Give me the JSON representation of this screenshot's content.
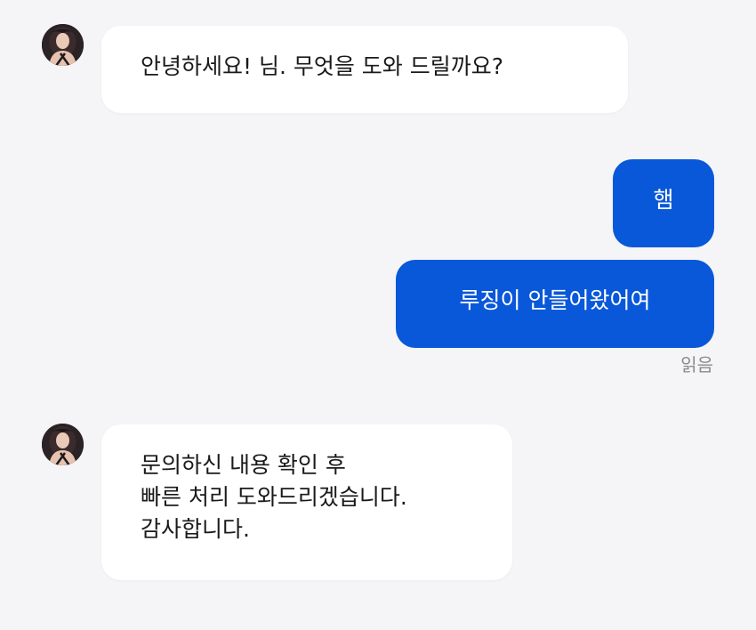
{
  "messages": [
    {
      "sender": "agent",
      "text": "안녕하세요! 님. 무엇을 도와 드릴까요?"
    },
    {
      "sender": "user",
      "text": "햄"
    },
    {
      "sender": "user",
      "text": "루징이 안들어왔어여"
    },
    {
      "sender": "agent",
      "text": "문의하신 내용 확인 후\n빠른 처리 도와드리겠습니다.\n감사합니다."
    }
  ],
  "read_receipt": "읽음",
  "icons": {
    "agent_avatar": "profile-photo-icon"
  },
  "colors": {
    "background": "#f5f5f7",
    "incoming_bubble": "#ffffff",
    "outgoing_bubble": "#0958d9",
    "read_receipt": "#8a8a8e"
  }
}
